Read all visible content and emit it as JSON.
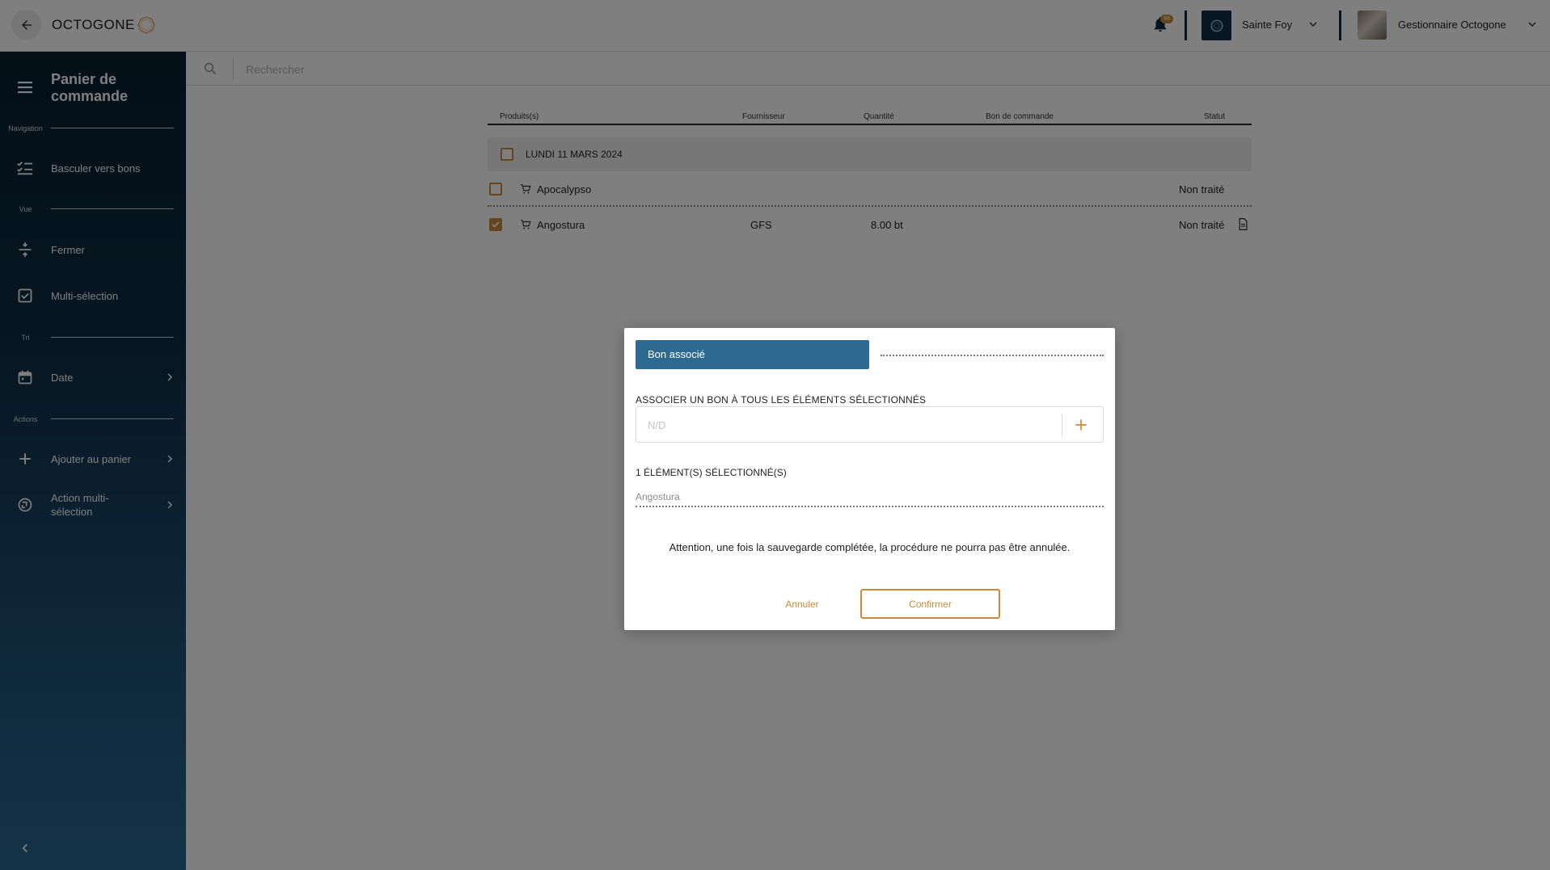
{
  "app": {
    "brand": "OCTOGONE",
    "notification_badge": "99",
    "site_name": "Sainte Foy",
    "user_name": "Gestionnaire Octogone",
    "accent_color": "#c98a3c",
    "sidebar_color": "#0d2c43",
    "tab_color": "#2c6a92"
  },
  "sidebar": {
    "title": "Panier de commande",
    "sections": {
      "navigation": "Navigation",
      "vue": "Vue",
      "tri": "Tri",
      "actions": "Actions"
    },
    "items": {
      "basculer": "Basculer vers bons",
      "fermer": "Fermer",
      "multiselection": "Multi-sélection",
      "date": "Date",
      "ajouter": "Ajouter au panier",
      "action_multi": "Action multi-sélection"
    }
  },
  "search": {
    "placeholder": "Rechercher"
  },
  "table": {
    "headers": {
      "produits": "Produits(s)",
      "fournisseur": "Fournisseur",
      "quantite": "Quantité",
      "bon": "Bon de commande",
      "statut": "Statut"
    },
    "group_label": "LUNDI 11 MARS 2024",
    "rows": [
      {
        "product": "Apocalypso",
        "supplier": "",
        "quantity": "",
        "order": "",
        "status": "Non traité",
        "checked": false
      },
      {
        "product": "Angostura",
        "supplier": "GFS",
        "quantity": "8.00 bt",
        "order": "",
        "status": "Non traité",
        "checked": true
      }
    ]
  },
  "modal": {
    "tab_label": "Bon associé",
    "assoc_label": "ASSOCIER UN BON À TOUS LES ÉLÉMENTS SÉLECTIONNÉS",
    "input_placeholder": "N/D",
    "selected_count_label": "1 ÉLÉMENT(S) SÉLECTIONNÉ(S)",
    "selected_item": "Angostura",
    "warning": "Attention, une fois la sauvegarde complétée, la procédure ne pourra pas être annulée.",
    "cancel_label": "Annuler",
    "confirm_label": "Confirmer"
  }
}
